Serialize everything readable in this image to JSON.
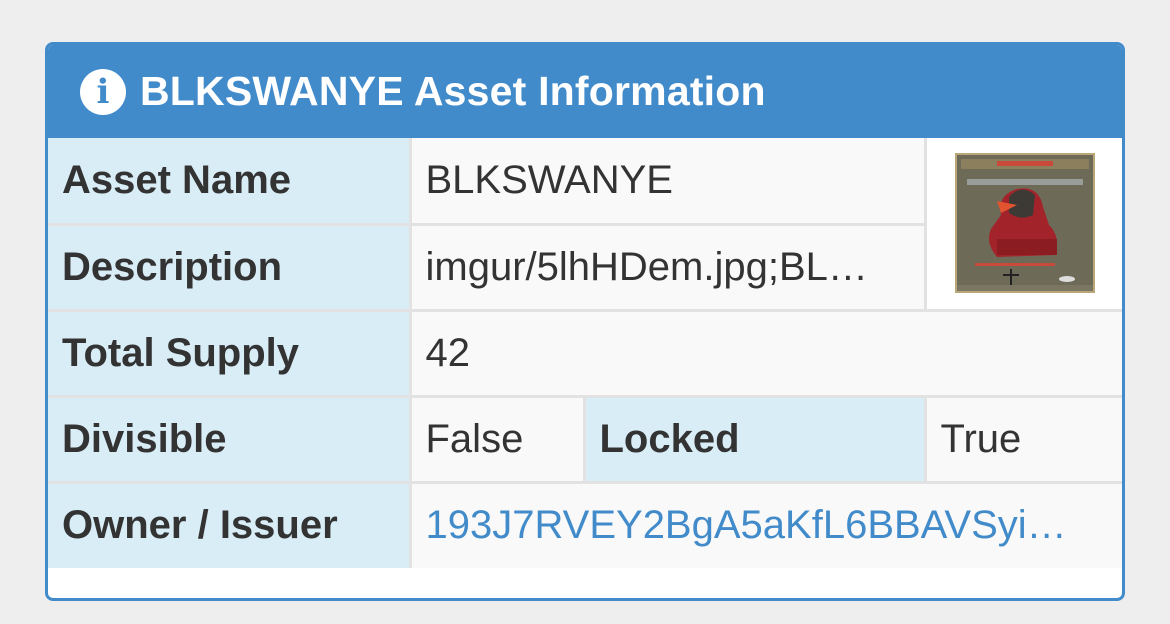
{
  "panel": {
    "title": "BLKSWANYE Asset Information",
    "info_icon": "info-circle-icon",
    "header_color": "#428bca",
    "label_bg": "#d9edf7"
  },
  "rows": {
    "asset_name": {
      "label": "Asset Name",
      "value": "BLKSWANYE"
    },
    "description": {
      "label": "Description",
      "value": "imgur/5lhHDem.jpg;BL…"
    },
    "total_supply": {
      "label": "Total Supply",
      "value": "42"
    },
    "divisible": {
      "label": "Divisible",
      "value": "False"
    },
    "locked": {
      "label": "Locked",
      "value": "True"
    },
    "owner": {
      "label": "Owner / Issuer",
      "value": "193J7RVEY2BgA5aKfL6BBAVSyi…"
    }
  },
  "image": {
    "name": "asset-thumbnail"
  }
}
